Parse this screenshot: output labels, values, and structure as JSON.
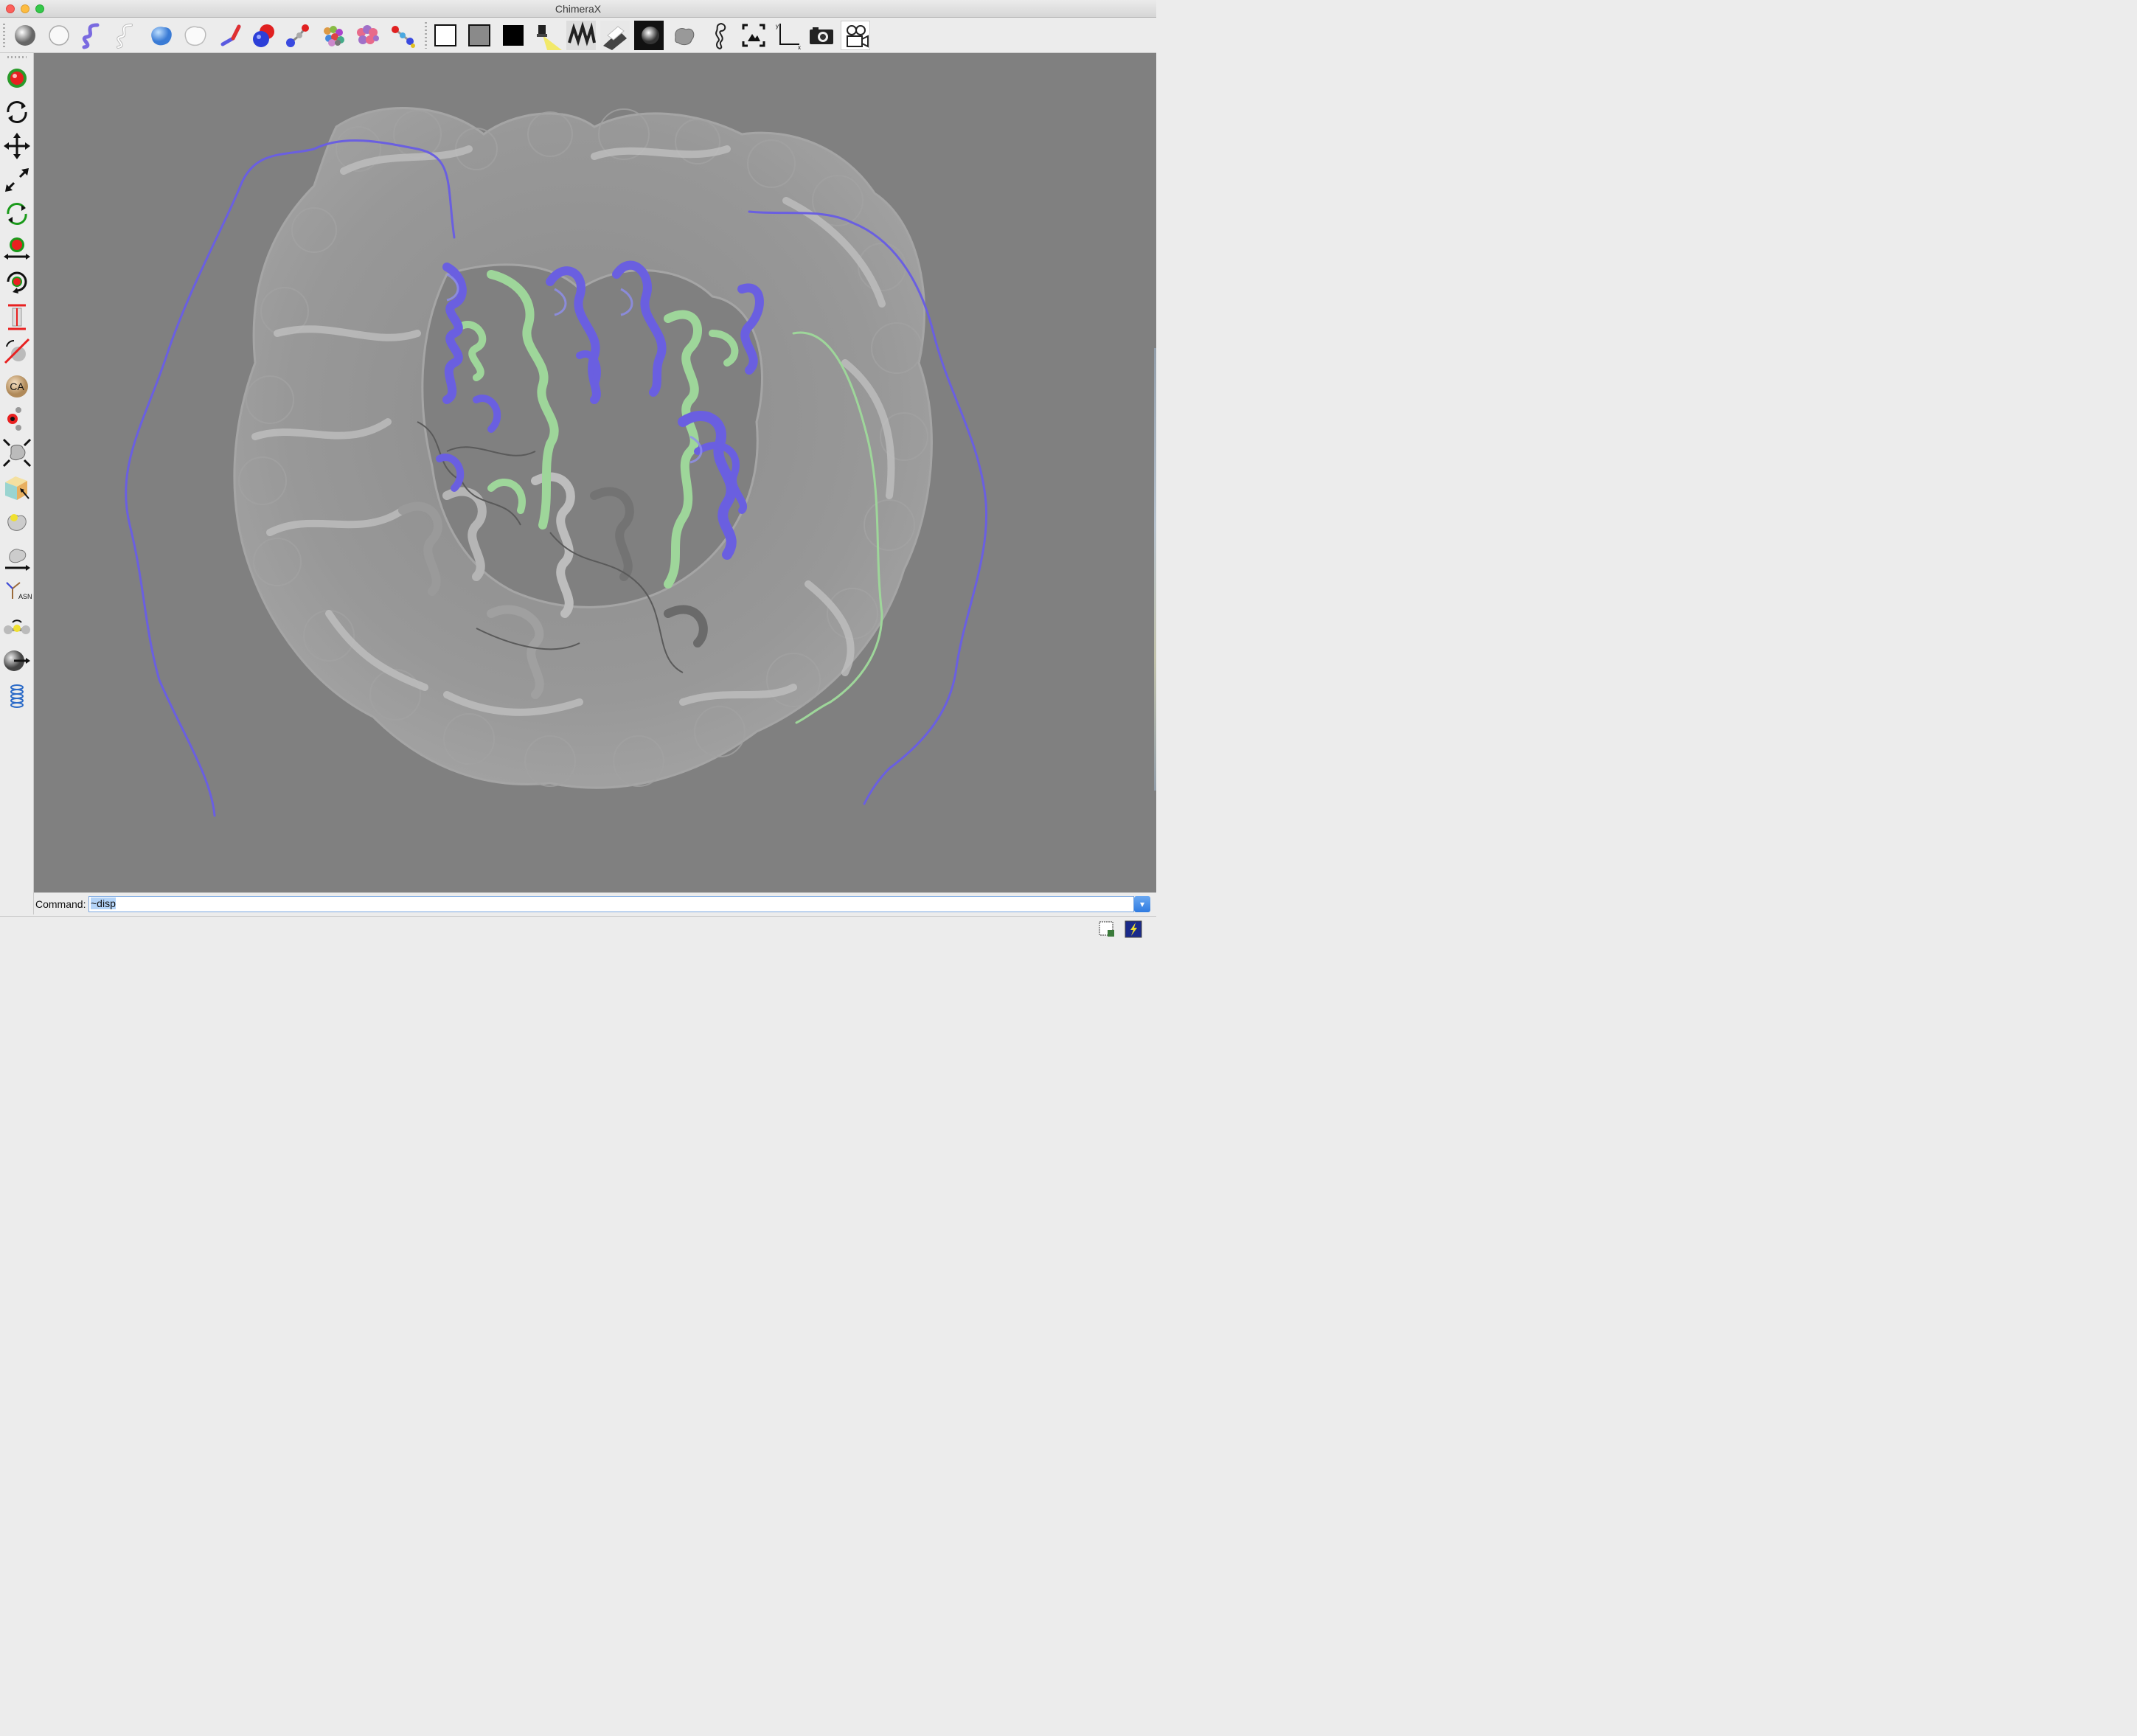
{
  "window": {
    "title": "ChimeraX"
  },
  "toolbar": {
    "icons": [
      "atoms-ball-icon",
      "atoms-hide-icon",
      "cartoon-show-icon",
      "cartoon-hide-icon",
      "surface-show-icon",
      "surface-hide-icon",
      "stick-icon",
      "sphere-icon",
      "ball-and-stick-icon",
      "color-by-chain-icon",
      "color-by-polymer-icon",
      "color-by-element-icon",
      "background-white-icon",
      "background-gray-icon",
      "background-black-icon",
      "lighting-simple-icon",
      "lighting-soft-icon",
      "lighting-full-icon",
      "lighting-flat-icon",
      "silhouette-icon",
      "seahorse-icon",
      "view-all-icon",
      "axes-icon",
      "snapshot-camera-icon",
      "movie-camera-icon"
    ]
  },
  "left_toolbar": {
    "icons": [
      "select-mouse-icon",
      "rotate-mouse-icon",
      "translate-mouse-icon",
      "zoom-mouse-icon",
      "rotate-selected-icon",
      "translate-selected-icon",
      "move-picked-icon",
      "distance-icon",
      "delete-distance-icon",
      "label-icon",
      "pivot-icon",
      "map-contour-icon",
      "move-planes-icon",
      "pick-blobs-icon",
      "map-move-icon",
      "swapaa-icon",
      "bond-rotation-icon",
      "tug-icon",
      "zone-icon"
    ],
    "ca_label": "CA",
    "asn_label": "ASN"
  },
  "viewport": {
    "background_color": "#808080",
    "surface_color": "#9a9a9a",
    "chain_colors": {
      "blue": "#6a5fe0",
      "green": "#9ed69a",
      "gray": "#b0b0b0",
      "dark_gray": "#6e6e6e"
    }
  },
  "command": {
    "label": "Command:",
    "value": "~disp"
  },
  "statusbar": {
    "icons": [
      "log-window-icon",
      "python-shell-icon"
    ]
  }
}
